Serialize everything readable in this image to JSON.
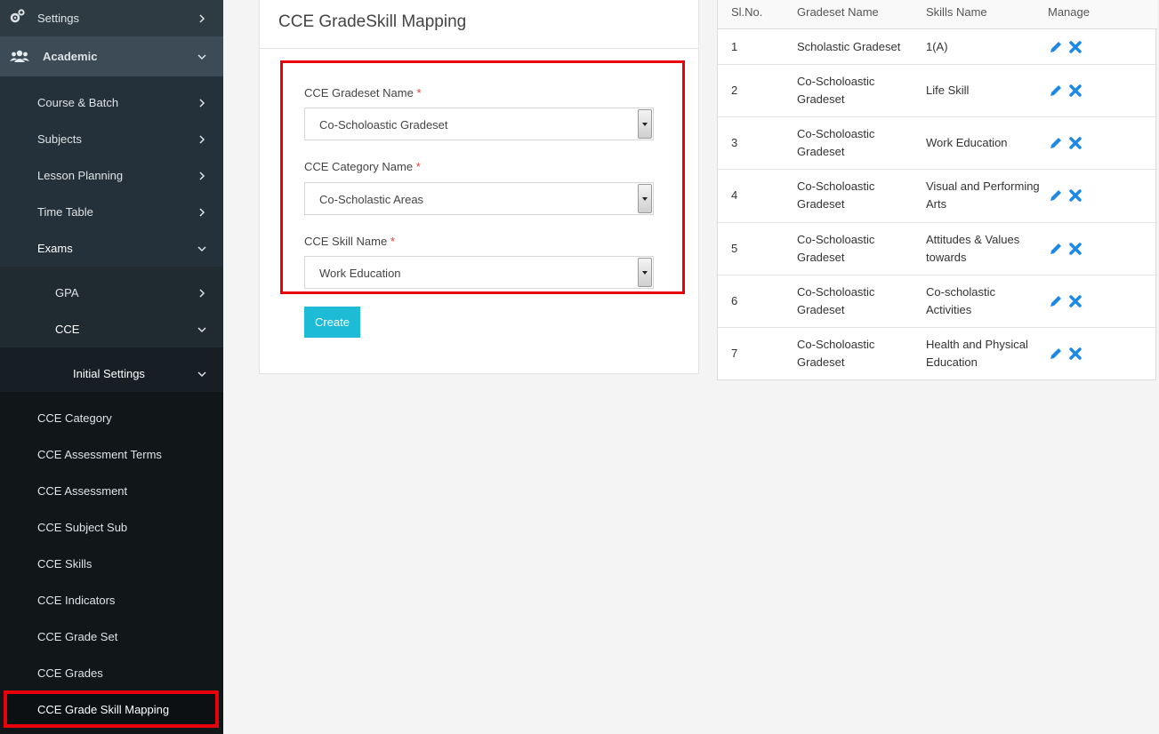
{
  "sidebar": {
    "settings": "Settings",
    "academic": "Academic",
    "course_batch": "Course & Batch",
    "subjects": "Subjects",
    "lesson_planning": "Lesson Planning",
    "time_table": "Time Table",
    "exams": "Exams",
    "gpa": "GPA",
    "cce": "CCE",
    "initial_settings": "Initial Settings",
    "cce_items": [
      "CCE Category",
      "CCE Assessment Terms",
      "CCE Assessment",
      "CCE Subject Sub",
      "CCE Skills",
      "CCE Indicators",
      "CCE Grade Set",
      "CCE Grades",
      "CCE Grade Skill Mapping"
    ],
    "icons": {
      "settings": "gears-icon",
      "academic": "users-icon"
    }
  },
  "form": {
    "title": "CCE GradeSkill Mapping",
    "required_mark": "*",
    "gradeset_label": "CCE Gradeset Name",
    "gradeset_value": "Co-Scholoastic Gradeset",
    "category_label": "CCE Category Name",
    "category_value": "Co-Scholastic Areas",
    "skill_label": "CCE Skill Name",
    "skill_value": "Work Education",
    "create_label": "Create"
  },
  "table": {
    "headers": [
      "Sl.No.",
      "Gradeset Name",
      "Skills Name",
      "Manage"
    ],
    "rows": [
      {
        "sl": "1",
        "gradeset": "Scholastic Gradeset",
        "skill": "1(A)"
      },
      {
        "sl": "2",
        "gradeset": "Co-Scholoastic Gradeset",
        "skill": "Life Skill"
      },
      {
        "sl": "3",
        "gradeset": "Co-Scholoastic Gradeset",
        "skill": "Work Education"
      },
      {
        "sl": "4",
        "gradeset": "Co-Scholoastic Gradeset",
        "skill": "Visual and Performing Arts"
      },
      {
        "sl": "5",
        "gradeset": "Co-Scholoastic Gradeset",
        "skill": "Attitudes & Values towards"
      },
      {
        "sl": "6",
        "gradeset": "Co-Scholoastic Gradeset",
        "skill": "Co-scholastic Activities"
      },
      {
        "sl": "7",
        "gradeset": "Co-Scholoastic Gradeset",
        "skill": "Health and Physical Education"
      }
    ]
  },
  "colors": {
    "accent": "#1ebbd7",
    "highlight": "#e8000b",
    "action_blue": "#1e88e5"
  }
}
